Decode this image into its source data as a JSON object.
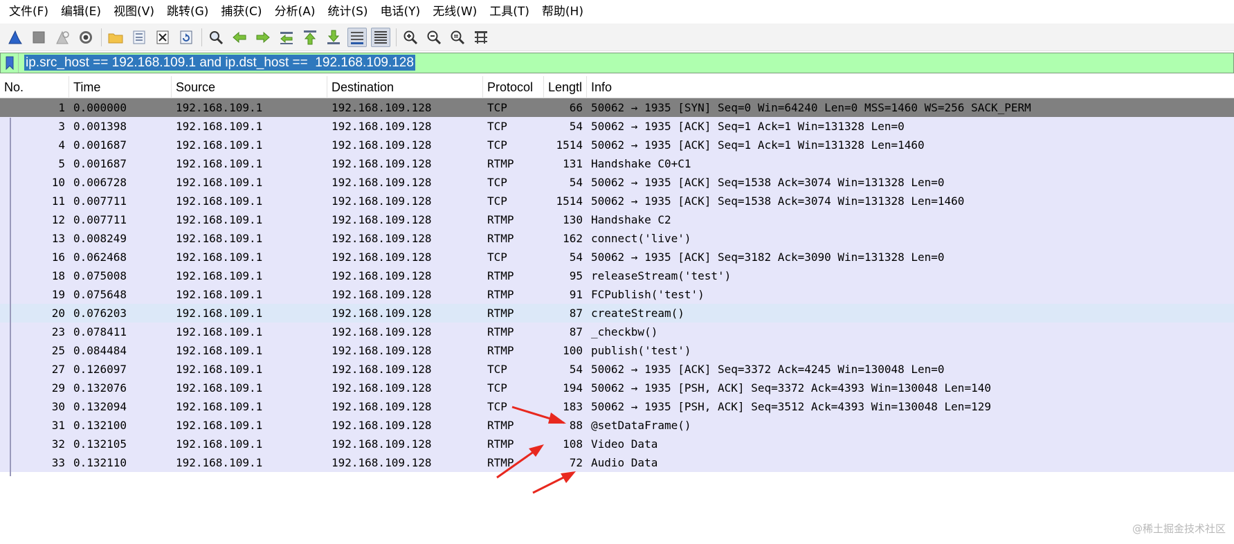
{
  "menu": [
    "文件(F)",
    "编辑(E)",
    "视图(V)",
    "跳转(G)",
    "捕获(C)",
    "分析(A)",
    "统计(S)",
    "电话(Y)",
    "无线(W)",
    "工具(T)",
    "帮助(H)"
  ],
  "toolbar": {
    "icons": [
      "shark-fin-start-icon",
      "stop-square-icon",
      "restart-fin-icon",
      "capture-options-gear-icon",
      "open-folder-icon",
      "save-file-icon",
      "close-file-icon",
      "reload-icon",
      "find-magnifier-icon",
      "go-back-arrow-icon",
      "go-forward-arrow-icon",
      "go-to-packet-icon",
      "first-packet-icon",
      "last-packet-icon",
      "auto-scroll-icon",
      "colorize-icon",
      "zoom-in-icon",
      "zoom-out-icon",
      "normal-size-icon",
      "resize-columns-icon"
    ]
  },
  "filter": {
    "expression": "ip.src_host == 192.168.109.1 and ip.dst_host ==  192.168.109.128"
  },
  "columns": {
    "no": "No.",
    "time": "Time",
    "source": "Source",
    "destination": "Destination",
    "protocol": "Protocol",
    "length": "Lengtl",
    "info": "Info"
  },
  "packets": [
    {
      "no": "1",
      "time": "0.000000",
      "src": "192.168.109.1",
      "dst": "192.168.109.128",
      "proto": "TCP",
      "len": "66",
      "info": "50062 → 1935 [SYN] Seq=0 Win=64240 Len=0 MSS=1460 WS=256 SACK_PERM"
    },
    {
      "no": "3",
      "time": "0.001398",
      "src": "192.168.109.1",
      "dst": "192.168.109.128",
      "proto": "TCP",
      "len": "54",
      "info": "50062 → 1935 [ACK] Seq=1 Ack=1 Win=131328 Len=0"
    },
    {
      "no": "4",
      "time": "0.001687",
      "src": "192.168.109.1",
      "dst": "192.168.109.128",
      "proto": "TCP",
      "len": "1514",
      "info": "50062 → 1935 [ACK] Seq=1 Ack=1 Win=131328 Len=1460"
    },
    {
      "no": "5",
      "time": "0.001687",
      "src": "192.168.109.1",
      "dst": "192.168.109.128",
      "proto": "RTMP",
      "len": "131",
      "info": "Handshake C0+C1"
    },
    {
      "no": "10",
      "time": "0.006728",
      "src": "192.168.109.1",
      "dst": "192.168.109.128",
      "proto": "TCP",
      "len": "54",
      "info": "50062 → 1935 [ACK] Seq=1538 Ack=3074 Win=131328 Len=0"
    },
    {
      "no": "11",
      "time": "0.007711",
      "src": "192.168.109.1",
      "dst": "192.168.109.128",
      "proto": "TCP",
      "len": "1514",
      "info": "50062 → 1935 [ACK] Seq=1538 Ack=3074 Win=131328 Len=1460"
    },
    {
      "no": "12",
      "time": "0.007711",
      "src": "192.168.109.1",
      "dst": "192.168.109.128",
      "proto": "RTMP",
      "len": "130",
      "info": "Handshake C2"
    },
    {
      "no": "13",
      "time": "0.008249",
      "src": "192.168.109.1",
      "dst": "192.168.109.128",
      "proto": "RTMP",
      "len": "162",
      "info": "connect('live')"
    },
    {
      "no": "16",
      "time": "0.062468",
      "src": "192.168.109.1",
      "dst": "192.168.109.128",
      "proto": "TCP",
      "len": "54",
      "info": "50062 → 1935 [ACK] Seq=3182 Ack=3090 Win=131328 Len=0"
    },
    {
      "no": "18",
      "time": "0.075008",
      "src": "192.168.109.1",
      "dst": "192.168.109.128",
      "proto": "RTMP",
      "len": "95",
      "info": "releaseStream('test')"
    },
    {
      "no": "19",
      "time": "0.075648",
      "src": "192.168.109.1",
      "dst": "192.168.109.128",
      "proto": "RTMP",
      "len": "91",
      "info": "FCPublish('test')"
    },
    {
      "no": "20",
      "time": "0.076203",
      "src": "192.168.109.1",
      "dst": "192.168.109.128",
      "proto": "RTMP",
      "len": "87",
      "info": "createStream()"
    },
    {
      "no": "23",
      "time": "0.078411",
      "src": "192.168.109.1",
      "dst": "192.168.109.128",
      "proto": "RTMP",
      "len": "87",
      "info": "_checkbw()"
    },
    {
      "no": "25",
      "time": "0.084484",
      "src": "192.168.109.1",
      "dst": "192.168.109.128",
      "proto": "RTMP",
      "len": "100",
      "info": "publish('test')"
    },
    {
      "no": "27",
      "time": "0.126097",
      "src": "192.168.109.1",
      "dst": "192.168.109.128",
      "proto": "TCP",
      "len": "54",
      "info": "50062 → 1935 [ACK] Seq=3372 Ack=4245 Win=130048 Len=0"
    },
    {
      "no": "29",
      "time": "0.132076",
      "src": "192.168.109.1",
      "dst": "192.168.109.128",
      "proto": "TCP",
      "len": "194",
      "info": "50062 → 1935 [PSH, ACK] Seq=3372 Ack=4393 Win=130048 Len=140"
    },
    {
      "no": "30",
      "time": "0.132094",
      "src": "192.168.109.1",
      "dst": "192.168.109.128",
      "proto": "TCP",
      "len": "183",
      "info": "50062 → 1935 [PSH, ACK] Seq=3512 Ack=4393 Win=130048 Len=129"
    },
    {
      "no": "31",
      "time": "0.132100",
      "src": "192.168.109.1",
      "dst": "192.168.109.128",
      "proto": "RTMP",
      "len": "88",
      "info": "@setDataFrame()"
    },
    {
      "no": "32",
      "time": "0.132105",
      "src": "192.168.109.1",
      "dst": "192.168.109.128",
      "proto": "RTMP",
      "len": "108",
      "info": "Video Data"
    },
    {
      "no": "33",
      "time": "0.132110",
      "src": "192.168.109.1",
      "dst": "192.168.109.128",
      "proto": "RTMP",
      "len": "72",
      "info": "Audio Data"
    }
  ],
  "selected_row": 0,
  "hover_row": 11,
  "colors": {
    "row_bg": "#e6e6fa",
    "selected_bg": "#808080",
    "hover_bg": "#dce8f8",
    "filter_bg": "#afffaf",
    "annotation_arrow": "#e8281e"
  },
  "watermark": "@稀土掘金技术社区"
}
